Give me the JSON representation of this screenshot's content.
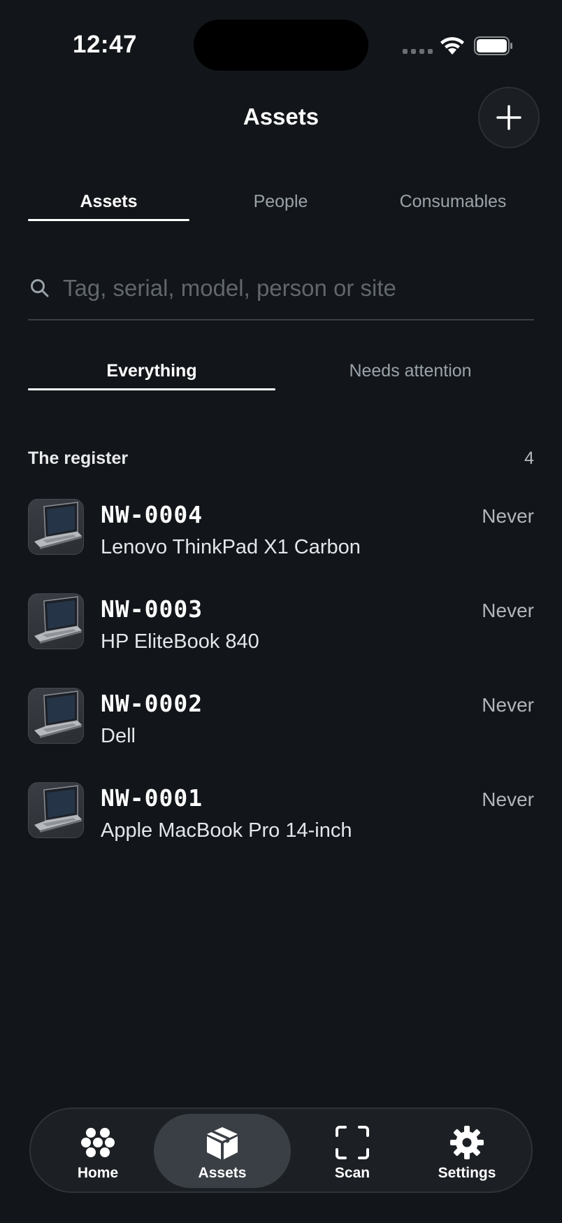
{
  "status_bar": {
    "time": "12:47"
  },
  "header": {
    "title": "Assets"
  },
  "tabs": [
    {
      "label": "Assets",
      "active": true
    },
    {
      "label": "People",
      "active": false
    },
    {
      "label": "Consumables",
      "active": false
    }
  ],
  "search": {
    "placeholder": "Tag, serial, model, person or site",
    "value": ""
  },
  "filters": [
    {
      "label": "Everything",
      "active": true
    },
    {
      "label": "Needs attention",
      "active": false
    }
  ],
  "section": {
    "title": "The register",
    "count": "4"
  },
  "assets": [
    {
      "tag": "NW-0004",
      "model": "Lenovo ThinkPad X1 Carbon",
      "last_seen": "Never",
      "icon": "laptop-icon"
    },
    {
      "tag": "NW-0003",
      "model": "HP EliteBook 840",
      "last_seen": "Never",
      "icon": "laptop-icon"
    },
    {
      "tag": "NW-0002",
      "model": "Dell",
      "last_seen": "Never",
      "icon": "laptop-icon"
    },
    {
      "tag": "NW-0001",
      "model": "Apple MacBook Pro 14-inch",
      "last_seen": "Never",
      "icon": "laptop-icon"
    }
  ],
  "tabbar": [
    {
      "label": "Home",
      "icon": "home-icon",
      "active": false
    },
    {
      "label": "Assets",
      "icon": "box-icon",
      "active": true
    },
    {
      "label": "Scan",
      "icon": "scan-icon",
      "active": false
    },
    {
      "label": "Settings",
      "icon": "gear-icon",
      "active": false
    }
  ],
  "colors": {
    "background": "#121519",
    "accent": "#ffffff",
    "muted": "#9aa3aa"
  }
}
